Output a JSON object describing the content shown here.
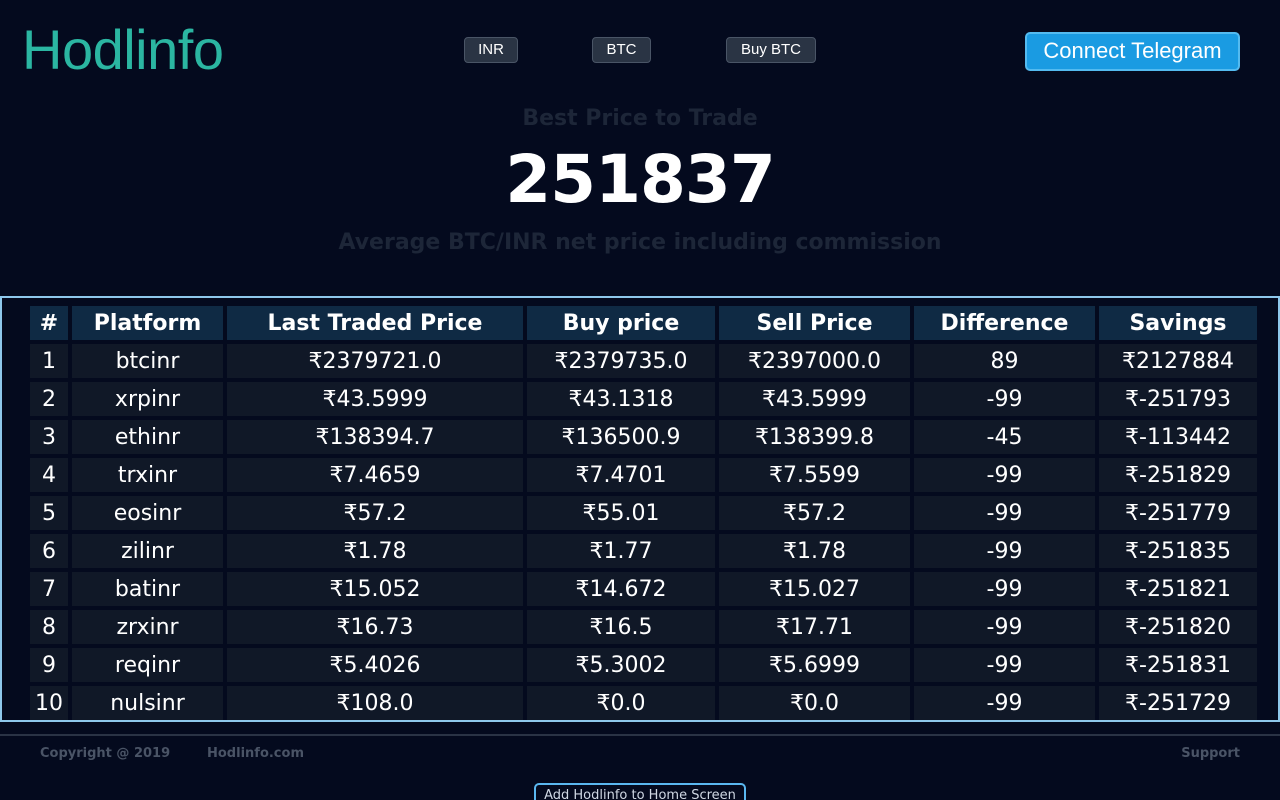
{
  "header": {
    "logo": "Hodlinfo",
    "currency_select": "INR",
    "coin_select": "BTC",
    "buy_button": "Buy BTC",
    "telegram_button": "Connect Telegram"
  },
  "hero": {
    "best_price_label": "Best Price to Trade",
    "best_price_value": "251837",
    "average_label": "Average BTC/INR net price including commission"
  },
  "table": {
    "columns": [
      "#",
      "Platform",
      "Last Traded Price",
      "Buy price",
      "Sell Price",
      "Difference",
      "Savings"
    ],
    "rows": [
      [
        "1",
        "btcinr",
        "₹2379721.0",
        "₹2379735.0",
        "₹2397000.0",
        "89",
        "₹2127884"
      ],
      [
        "2",
        "xrpinr",
        "₹43.5999",
        "₹43.1318",
        "₹43.5999",
        "-99",
        "₹-251793"
      ],
      [
        "3",
        "ethinr",
        "₹138394.7",
        "₹136500.9",
        "₹138399.8",
        "-45",
        "₹-113442"
      ],
      [
        "4",
        "trxinr",
        "₹7.4659",
        "₹7.4701",
        "₹7.5599",
        "-99",
        "₹-251829"
      ],
      [
        "5",
        "eosinr",
        "₹57.2",
        "₹55.01",
        "₹57.2",
        "-99",
        "₹-251779"
      ],
      [
        "6",
        "zilinr",
        "₹1.78",
        "₹1.77",
        "₹1.78",
        "-99",
        "₹-251835"
      ],
      [
        "7",
        "batinr",
        "₹15.052",
        "₹14.672",
        "₹15.027",
        "-99",
        "₹-251821"
      ],
      [
        "8",
        "zrxinr",
        "₹16.73",
        "₹16.5",
        "₹17.71",
        "-99",
        "₹-251820"
      ],
      [
        "9",
        "reqinr",
        "₹5.4026",
        "₹5.3002",
        "₹5.6999",
        "-99",
        "₹-251831"
      ],
      [
        "10",
        "nulsinr",
        "₹108.0",
        "₹0.0",
        "₹0.0",
        "-99",
        "₹-251729"
      ]
    ]
  },
  "footer": {
    "copyright": "Copyright @ 2019",
    "site": "Hodlinfo.com",
    "support": "Support",
    "add_home": "Add Hodlinfo to Home Screen"
  },
  "colors": {
    "background": "#040a1e",
    "logo": "#2bb6a2",
    "telegram": "#1a9be2",
    "table_header": "#0f2a44",
    "table_cell": "#101827",
    "table_border": "#8ec8ec"
  }
}
